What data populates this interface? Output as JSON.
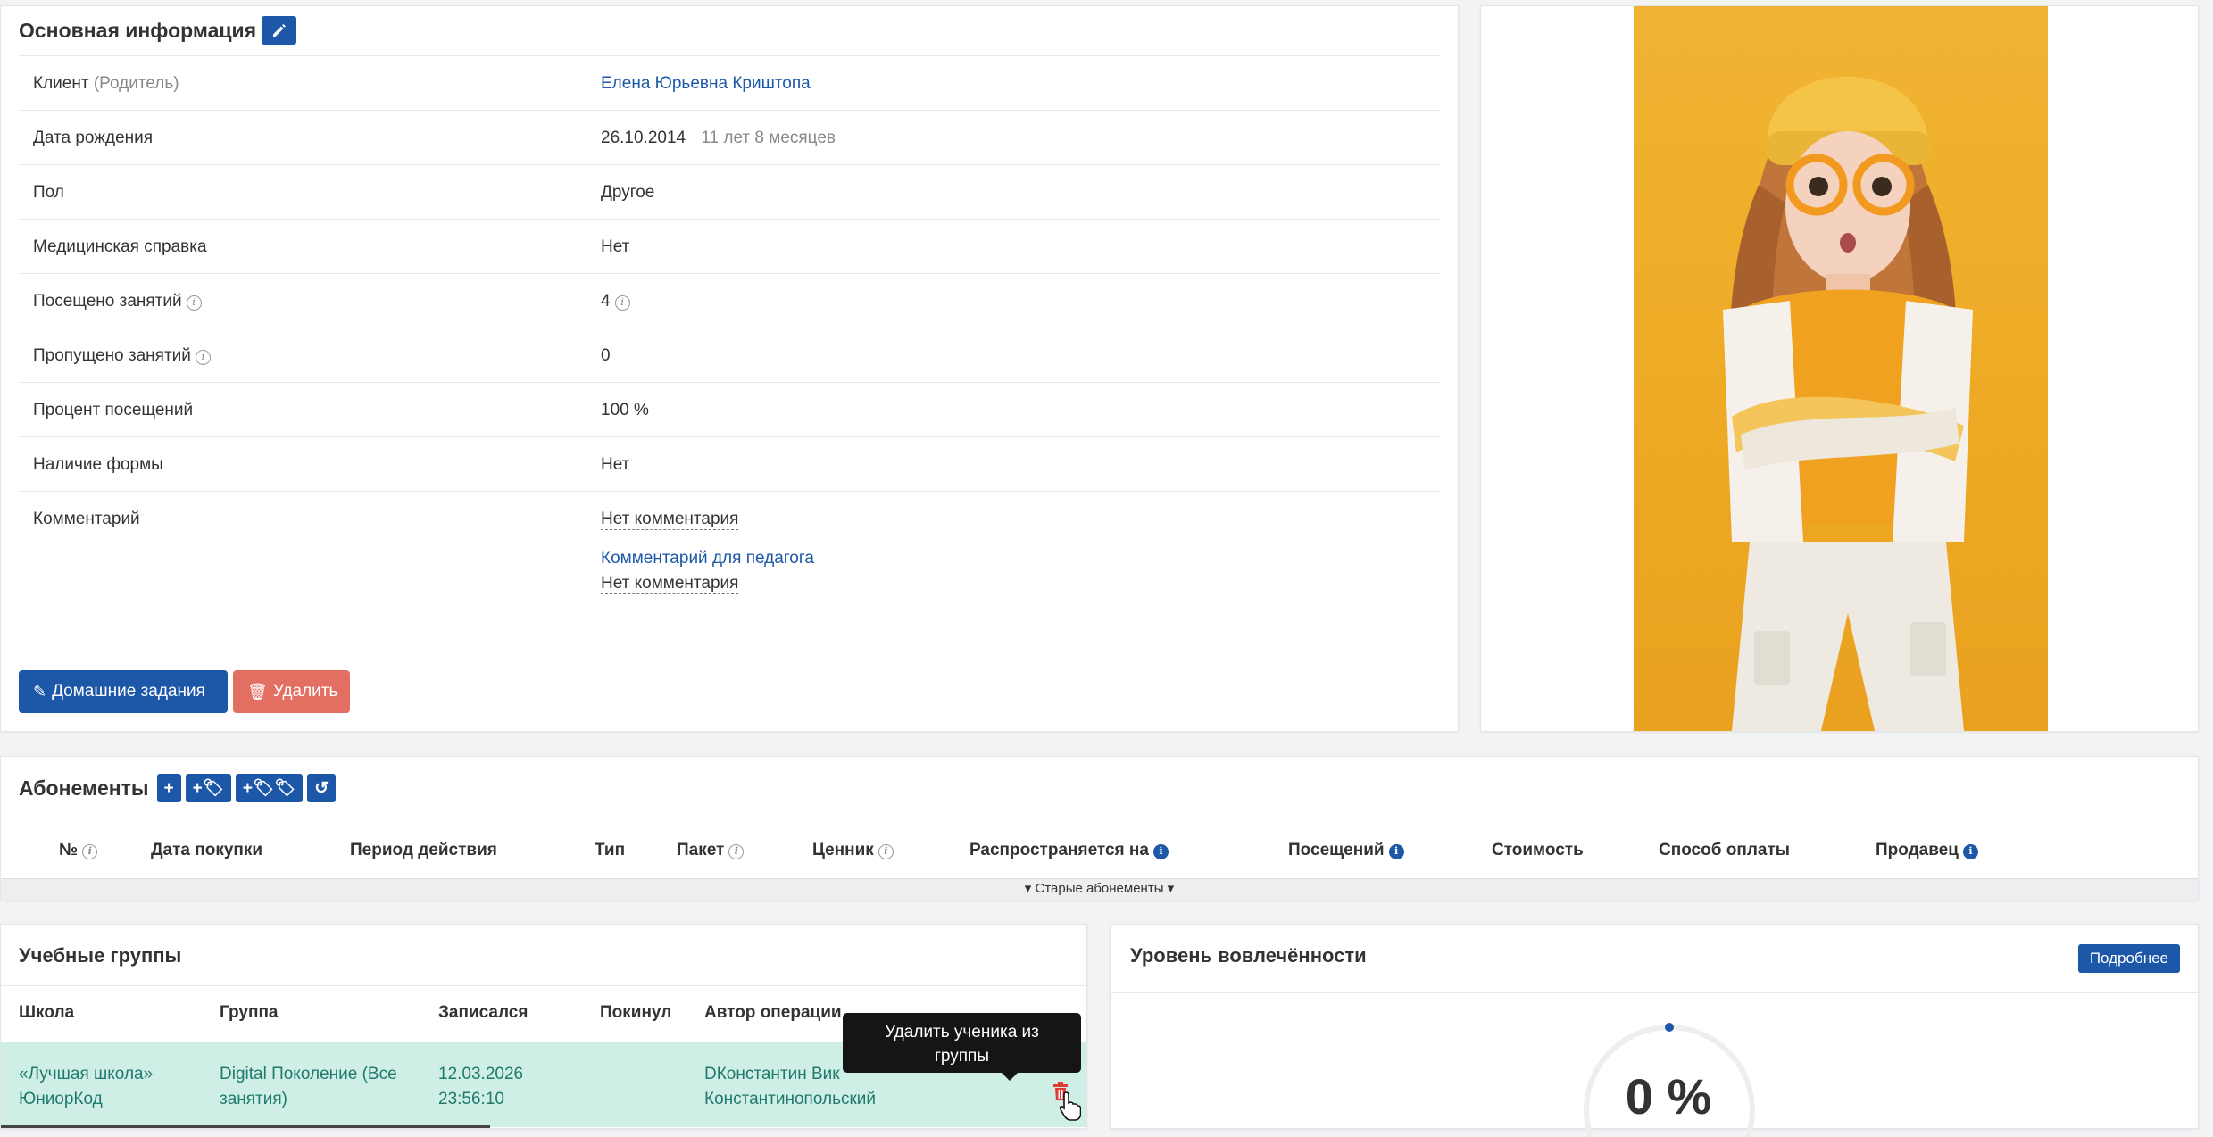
{
  "info": {
    "title": "Основная информация",
    "rows": [
      {
        "label": "Клиент",
        "label_suffix": "(Родитель)",
        "value": "Елена Юрьевна Криштопа"
      },
      {
        "label": "Дата рождения",
        "value": "26.10.2014",
        "value_extra": "11 лет 8 месяцев"
      },
      {
        "label": "Пол",
        "value": "Другое"
      },
      {
        "label": "Медицинская справка",
        "value": "Нет"
      },
      {
        "label": "Посещено занятий",
        "value": "4"
      },
      {
        "label": "Пропущено занятий",
        "value": "0"
      },
      {
        "label": "Процент посещений",
        "value": "100 %"
      },
      {
        "label": "Наличие формы",
        "value": "Нет"
      },
      {
        "label": "Комментарий",
        "value": "Нет комментария",
        "teacher_comment_label": "Комментарий для педагога",
        "teacher_comment_value": "Нет комментария"
      }
    ],
    "homework_button": "Домашние задания",
    "delete_button": "Удалить"
  },
  "subscriptions": {
    "title": "Абонементы",
    "columns": [
      "№",
      "Дата покупки",
      "Период действия",
      "Тип",
      "Пакет",
      "Ценник",
      "Распространяется на",
      "Посещений",
      "Стоимость",
      "Способ оплаты",
      "Продавец"
    ],
    "old_toggle": "Старые абонементы"
  },
  "groups": {
    "title": "Учебные группы",
    "columns": [
      "Школа",
      "Группа",
      "Записался",
      "Покинул",
      "Автор операции"
    ],
    "row": {
      "school_line1": "«Лучшая школа»",
      "school_line2": "ЮниорКод",
      "group_line1": "Digital Поколение (Все",
      "group_line2": "занятия)",
      "joined_date": "12.03.2026",
      "joined_time": "23:56:10",
      "left": "",
      "author_line1": "DКонстантин Вик",
      "author_line2": "Константинопольский"
    },
    "tooltip_line1": "Удалить ученика из",
    "tooltip_line2": "группы"
  },
  "engagement": {
    "title": "Уровень вовлечённости",
    "details_button": "Подробнее",
    "value_text": "0 %",
    "value": 0
  },
  "colors": {
    "primary": "#1d57a8",
    "danger": "#e36f63",
    "row_highlight": "#cfeee6",
    "photo_background": "#eeaa24"
  }
}
